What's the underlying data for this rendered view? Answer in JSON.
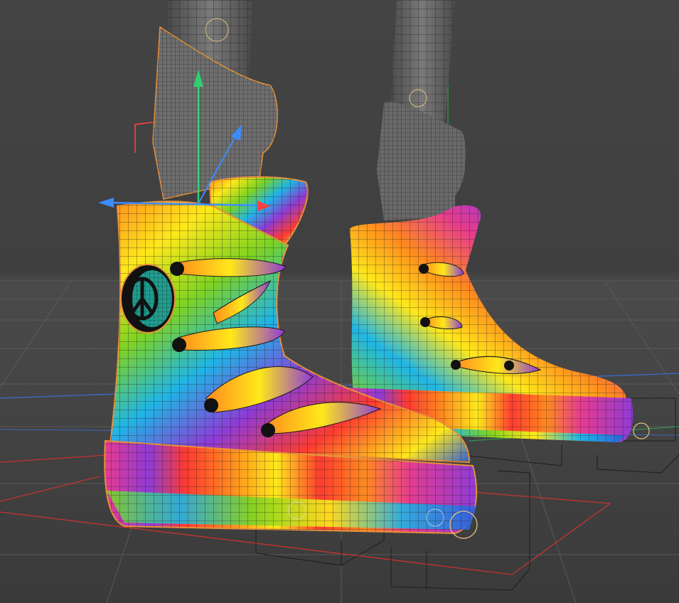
{
  "viewport": {
    "background": "#3b3b3b",
    "grid_color": "#5a5a5a",
    "axis_x_color": "#c83232",
    "axis_z_color": "#3a6fd6",
    "axis_y_color": "#2fa84f",
    "selection_outline_color": "#e8913a",
    "wire_color": "#1a1a1a",
    "rainbow_palette": [
      "#ff3b30",
      "#ff8a1e",
      "#ffe81a",
      "#7ed321",
      "#1fb5e6",
      "#2f5fd8",
      "#8e3bd6",
      "#e63b8f"
    ]
  },
  "gizmo": {
    "icon": "move-gizmo-icon",
    "x_axis_color": "#ff4040",
    "y_axis_color": "#30d070",
    "z_axis_color": "#3a8cff"
  },
  "objects": [
    {
      "name": "left-sock",
      "material": "gray-wireframe",
      "selected": false
    },
    {
      "name": "left-sneaker",
      "material": "rainbow-uv-checker",
      "selected": true
    },
    {
      "name": "right-sock",
      "material": "gray-wireframe",
      "selected": false
    },
    {
      "name": "right-sneaker",
      "material": "rainbow-uv-checker",
      "selected": false
    }
  ],
  "emblem": {
    "icon": "peace-sign-icon"
  }
}
